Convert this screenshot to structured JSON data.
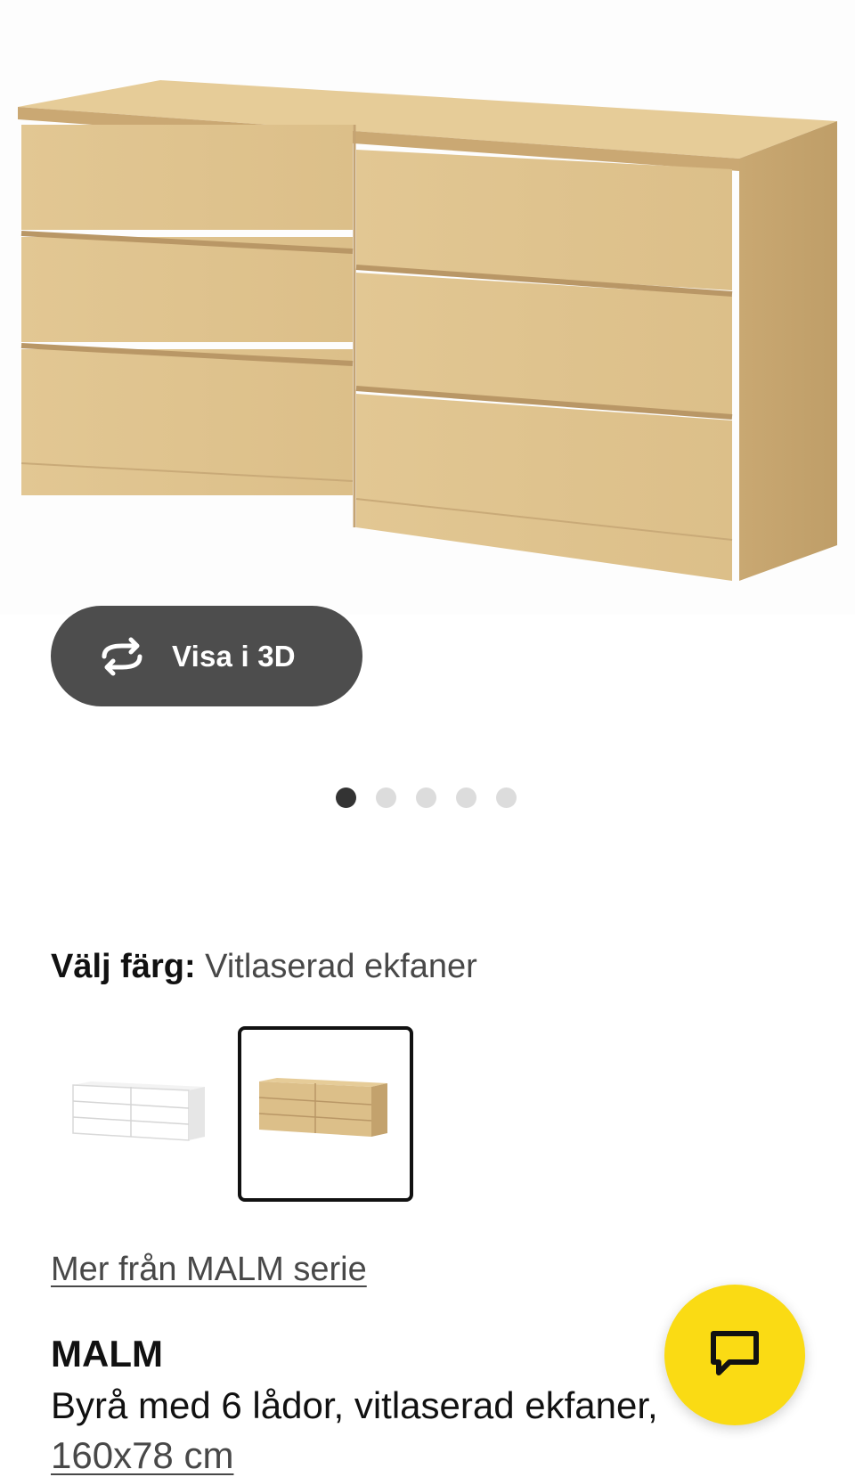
{
  "gallery": {
    "view3d_label": "Visa i 3D",
    "dots_total": 5,
    "dots_active_index": 0
  },
  "color_picker": {
    "label": "Välj färg:",
    "selected_value": "Vitlaserad ekfaner",
    "options": [
      {
        "name": "white",
        "color": "#ffffff",
        "selected": false
      },
      {
        "name": "oak",
        "color": "#d9bc88",
        "selected": true
      }
    ]
  },
  "series_link": "Mer från MALM serie",
  "product": {
    "name": "MALM",
    "description": "Byrå med 6 lådor, vitlaserad ekfaner,",
    "size": "160x78 cm"
  },
  "colors": {
    "accent_yellow": "#fadb14",
    "button_dark": "#4d4d4d",
    "oak": "#d9bc88",
    "dot_active": "#333333",
    "dot_inactive": "#dcdcdc"
  },
  "icons": {
    "top": "chevron-down-icon",
    "view3d": "rotate-3d-icon",
    "chat": "chat-bubble-icon"
  }
}
